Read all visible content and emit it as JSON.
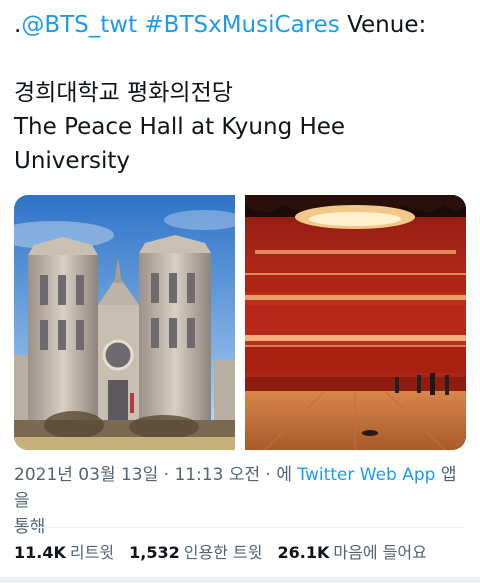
{
  "tweet": {
    "text_lead": ".",
    "mention": "@BTS_twt",
    "hashtag": "#BTSxMusiCares",
    "venue_word": "Venue:",
    "line_korean": "경희대학교 평화의전당",
    "line_english_1": "The Peace Hall at Kyung Hee",
    "line_english_2": "University"
  },
  "media": {
    "photos": [
      {
        "subject": "Kyung Hee University Peace Hall gothic building exterior"
      },
      {
        "subject": "Peace Hall auditorium interior with red seats and wooden stage"
      }
    ]
  },
  "meta": {
    "timestamp": "2021년 03월 13일 · 11:13 오전 · ",
    "via_prefix": "에 ",
    "app": "Twitter Web App",
    "via_suffix": " 앱을",
    "via_line2": "통해"
  },
  "stats": {
    "retweets_count": "11.4K",
    "retweets_label": "리트윗",
    "quotes_count": "1,532",
    "quotes_label": "인용한 트윗",
    "likes_count": "26.1K",
    "likes_label": "마음에 들어요"
  },
  "colors": {
    "link": "#1d9bf0",
    "text": "#0f1419",
    "muted": "#536471"
  }
}
